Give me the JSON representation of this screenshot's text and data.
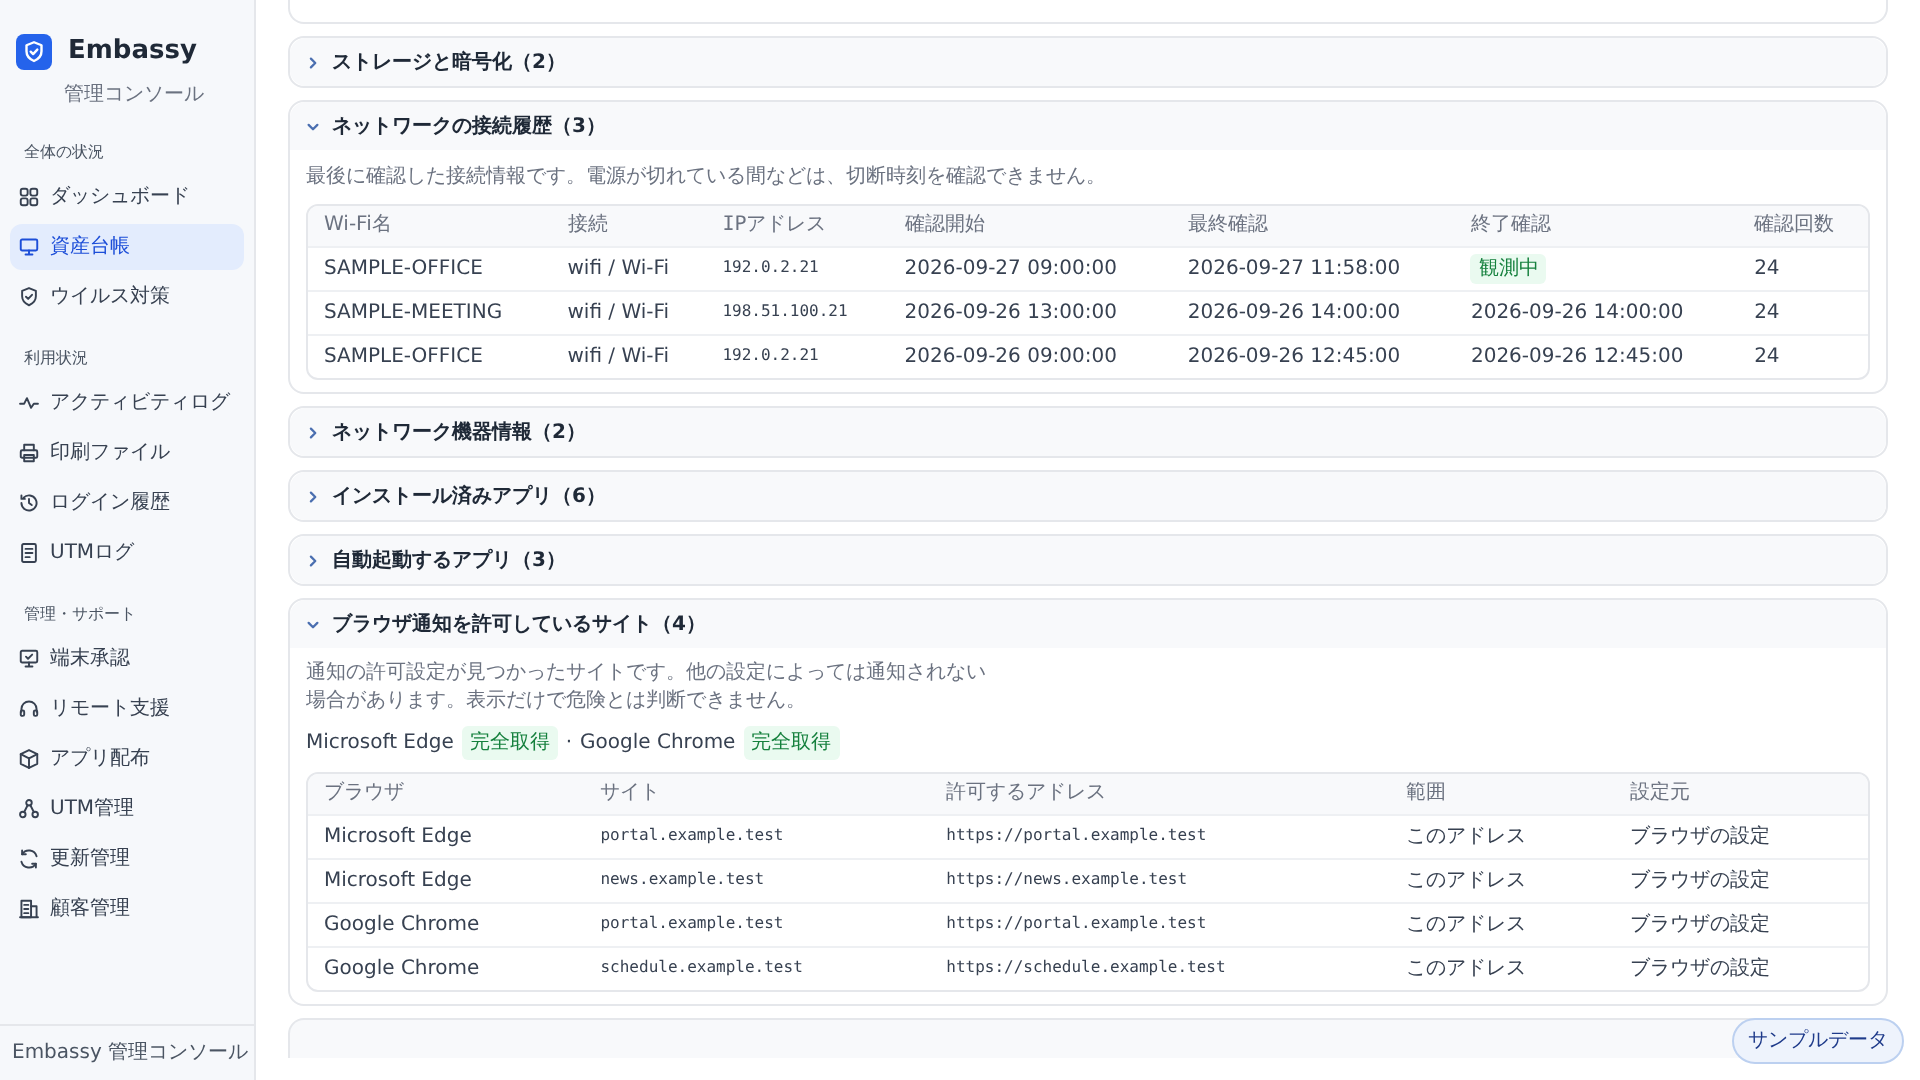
{
  "sidebar": {
    "brand": {
      "name": "Embassy",
      "subtitle": "管理コンソール"
    },
    "groups": [
      {
        "label": "全体の状況",
        "items": [
          {
            "label": "ダッシュボード",
            "selected": false
          },
          {
            "label": "資産台帳",
            "selected": true
          },
          {
            "label": "ウイルス対策",
            "selected": false
          }
        ]
      },
      {
        "label": "利用状況",
        "items": [
          {
            "label": "アクティビティログ",
            "selected": false
          },
          {
            "label": "印刷ファイル",
            "selected": false
          },
          {
            "label": "ログイン履歴",
            "selected": false
          },
          {
            "label": "UTMログ",
            "selected": false
          }
        ]
      },
      {
        "label": "管理・サポート",
        "items": [
          {
            "label": "端末承認",
            "selected": false
          },
          {
            "label": "リモート支援",
            "selected": false
          },
          {
            "label": "アプリ配布",
            "selected": false
          },
          {
            "label": "UTM管理",
            "selected": false
          },
          {
            "label": "更新管理",
            "selected": false
          },
          {
            "label": "顧客管理",
            "selected": false
          }
        ]
      }
    ],
    "footer": "Embassy 管理コンソール"
  },
  "sections": [
    {
      "title": "ストレージと暗号化（2）",
      "expanded": false
    },
    {
      "title": "ネットワークの接続履歴（3）",
      "expanded": true,
      "description": "最後に確認した接続情報です。電源が切れている間などは、切断時刻を確認できません。",
      "table": {
        "columns": [
          {
            "label": "Wi-Fi名",
            "mono": false
          },
          {
            "label": "接続",
            "mono": false
          },
          {
            "label": "IPアドレス",
            "mono": true
          },
          {
            "label": "確認開始",
            "mono": false
          },
          {
            "label": "最終確認",
            "mono": false
          },
          {
            "label": "終了確認",
            "mono": false
          },
          {
            "label": "確認回数",
            "mono": false
          }
        ],
        "rows": [
          [
            "SAMPLE-OFFICE",
            "wifi / Wi-Fi",
            "192.0.2.21",
            "2026-09-27 09:00:00",
            "2026-09-27 11:58:00",
            {
              "badge": "観測中"
            },
            "24"
          ],
          [
            "SAMPLE-MEETING",
            "wifi / Wi-Fi",
            "198.51.100.21",
            "2026-09-26 13:00:00",
            "2026-09-26 14:00:00",
            "2026-09-26 14:00:00",
            "24"
          ],
          [
            "SAMPLE-OFFICE",
            "wifi / Wi-Fi",
            "192.0.2.21",
            "2026-09-26 09:00:00",
            "2026-09-26 12:45:00",
            "2026-09-26 12:45:00",
            "24"
          ]
        ]
      }
    },
    {
      "title": "ネットワーク機器情報（2）",
      "expanded": false
    },
    {
      "title": "インストール済みアプリ（6）",
      "expanded": false
    },
    {
      "title": "自動起動するアプリ（3）",
      "expanded": false
    },
    {
      "title": "ブラウザ通知を許可しているサイト（4）",
      "expanded": true,
      "description": "通知の許可設定が見つかったサイトです。他の設定によっては通知されない場合があります。表示だけで危険とは判断できません。",
      "browsers": {
        "separator": "·",
        "items": [
          {
            "name": "Microsoft Edge",
            "status": "完全取得"
          },
          {
            "name": "Google Chrome",
            "status": "完全取得"
          }
        ]
      },
      "table": {
        "columns": [
          {
            "label": "ブラウザ",
            "mono": false
          },
          {
            "label": "サイト",
            "mono": true
          },
          {
            "label": "許可するアドレス",
            "mono": true
          },
          {
            "label": "範囲",
            "mono": false
          },
          {
            "label": "設定元",
            "mono": false
          }
        ],
        "rows": [
          [
            "Microsoft Edge",
            "portal.example.test",
            "https://portal.example.test",
            "このアドレス",
            "ブラウザの設定"
          ],
          [
            "Microsoft Edge",
            "news.example.test",
            "https://news.example.test",
            "このアドレス",
            "ブラウザの設定"
          ],
          [
            "Google Chrome",
            "portal.example.test",
            "https://portal.example.test",
            "このアドレス",
            "ブラウザの設定"
          ],
          [
            "Google Chrome",
            "schedule.example.test",
            "https://schedule.example.test",
            "このアドレス",
            "ブラウザの設定"
          ]
        ]
      }
    }
  ],
  "sample_badge": "サンプルデータ"
}
